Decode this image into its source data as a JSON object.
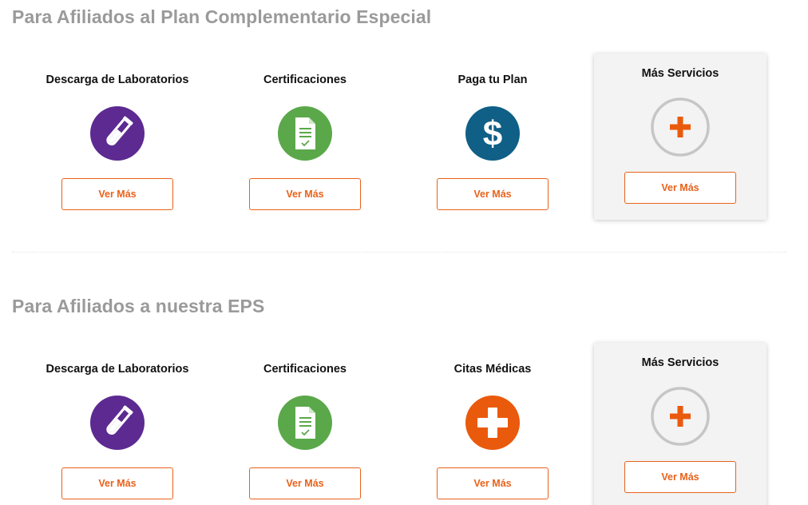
{
  "colors": {
    "accent": "#e8621b",
    "title_gray": "#9a9a9a",
    "purple": "#5c2a91",
    "green": "#5aa84a",
    "teal": "#0f5f86",
    "orange": "#ea5a0c",
    "highlight_bg": "#f3f3f3"
  },
  "sections": [
    {
      "title": "Para Afiliados al Plan Complementario Especial",
      "cards": [
        {
          "title": "Descarga de Laboratorios",
          "icon": "test-tube-icon",
          "button": "Ver Más"
        },
        {
          "title": "Certificaciones",
          "icon": "document-check-icon",
          "button": "Ver Más"
        },
        {
          "title": "Paga tu Plan",
          "icon": "dollar-icon",
          "button": "Ver Más"
        },
        {
          "title": "Más Servicios",
          "icon": "plus-icon",
          "button": "Ver Más"
        }
      ]
    },
    {
      "title": "Para Afiliados a nuestra EPS",
      "cards": [
        {
          "title": "Descarga de Laboratorios",
          "icon": "test-tube-icon",
          "button": "Ver Más"
        },
        {
          "title": "Certificaciones",
          "icon": "document-check-icon",
          "button": "Ver Más"
        },
        {
          "title": "Citas Médicas",
          "icon": "medical-cross-icon",
          "button": "Ver Más"
        },
        {
          "title": "Más Servicios",
          "icon": "plus-icon",
          "button": "Ver Más"
        }
      ]
    }
  ]
}
